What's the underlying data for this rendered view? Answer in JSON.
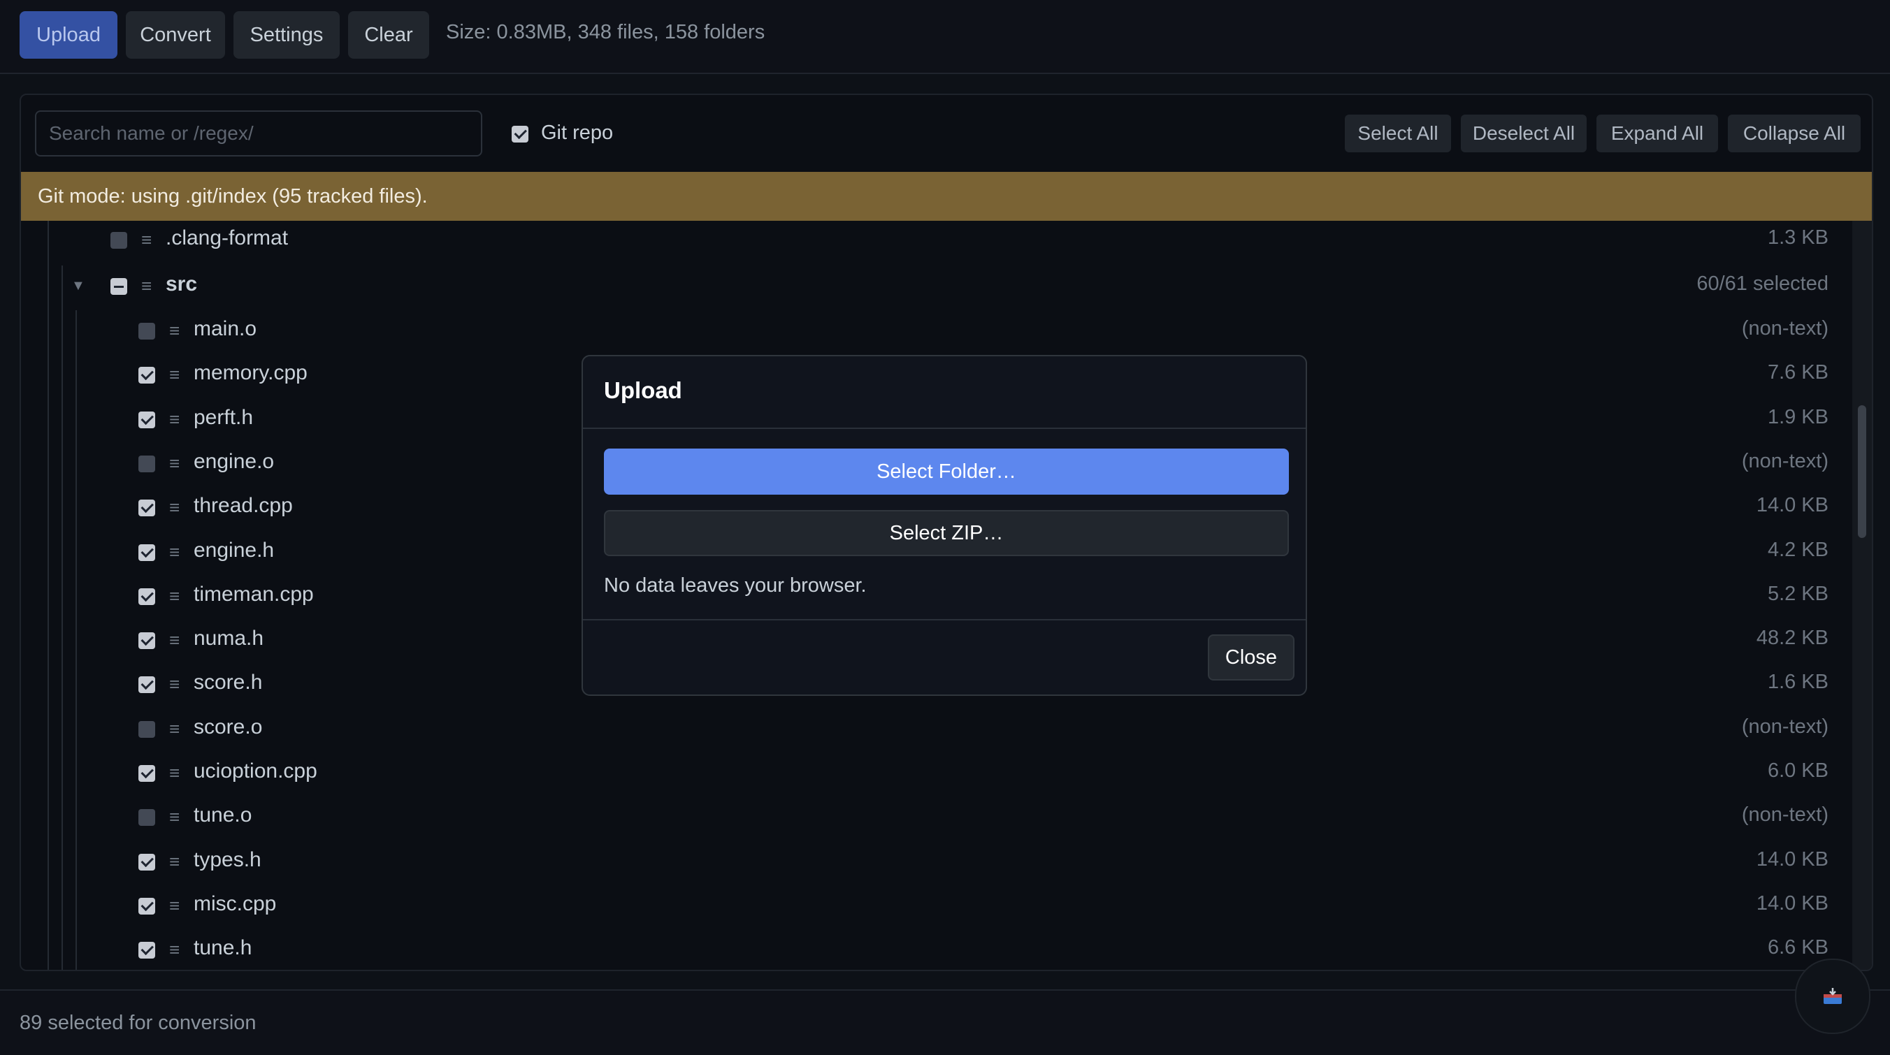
{
  "toolbar": {
    "upload": "Upload",
    "convert": "Convert",
    "settings": "Settings",
    "clear": "Clear",
    "size_text": "Size: 0.83MB, 348 files, 158 folders"
  },
  "filter": {
    "search_placeholder": "Search name or /regex/",
    "git_repo_label": "Git repo",
    "git_repo_checked": true,
    "select_all": "Select All",
    "deselect_all": "Deselect All",
    "expand_all": "Expand All",
    "collapse_all": "Collapse All"
  },
  "banner": "Git mode: using .git/index (95 tracked files).",
  "tree": {
    "clang_format": {
      "name": ".clang-format",
      "size": "1.3 KB",
      "checked": false
    },
    "src": {
      "name": "src",
      "info": "60/61 selected",
      "expanded": true,
      "state": "mixed"
    },
    "files": [
      {
        "name": "main.o",
        "size": "(non-text)",
        "checked": false
      },
      {
        "name": "memory.cpp",
        "size": "7.6 KB",
        "checked": true
      },
      {
        "name": "perft.h",
        "size": "1.9 KB",
        "checked": true
      },
      {
        "name": "engine.o",
        "size": "(non-text)",
        "checked": false
      },
      {
        "name": "thread.cpp",
        "size": "14.0 KB",
        "checked": true
      },
      {
        "name": "engine.h",
        "size": "4.2 KB",
        "checked": true
      },
      {
        "name": "timeman.cpp",
        "size": "5.2 KB",
        "checked": true
      },
      {
        "name": "numa.h",
        "size": "48.2 KB",
        "checked": true
      },
      {
        "name": "score.h",
        "size": "1.6 KB",
        "checked": true
      },
      {
        "name": "score.o",
        "size": "(non-text)",
        "checked": false
      },
      {
        "name": "ucioption.cpp",
        "size": "6.0 KB",
        "checked": true
      },
      {
        "name": "tune.o",
        "size": "(non-text)",
        "checked": false
      },
      {
        "name": "types.h",
        "size": "14.0 KB",
        "checked": true
      },
      {
        "name": "misc.cpp",
        "size": "14.0 KB",
        "checked": true
      },
      {
        "name": "tune.h",
        "size": "6.6 KB",
        "checked": true
      }
    ]
  },
  "status": "89 selected for conversion",
  "modal": {
    "title": "Upload",
    "select_folder": "Select Folder…",
    "select_zip": "Select ZIP…",
    "note": "No data leaves your browser.",
    "close": "Close"
  },
  "icons": {
    "tree_line": "lines-icon",
    "folder_arrow": "caret-down-icon",
    "fab": "inbox-tray-icon"
  },
  "colors": {
    "accent": "#5d87ee",
    "primary_button": "#3451a3",
    "banner": "#7a6334"
  }
}
